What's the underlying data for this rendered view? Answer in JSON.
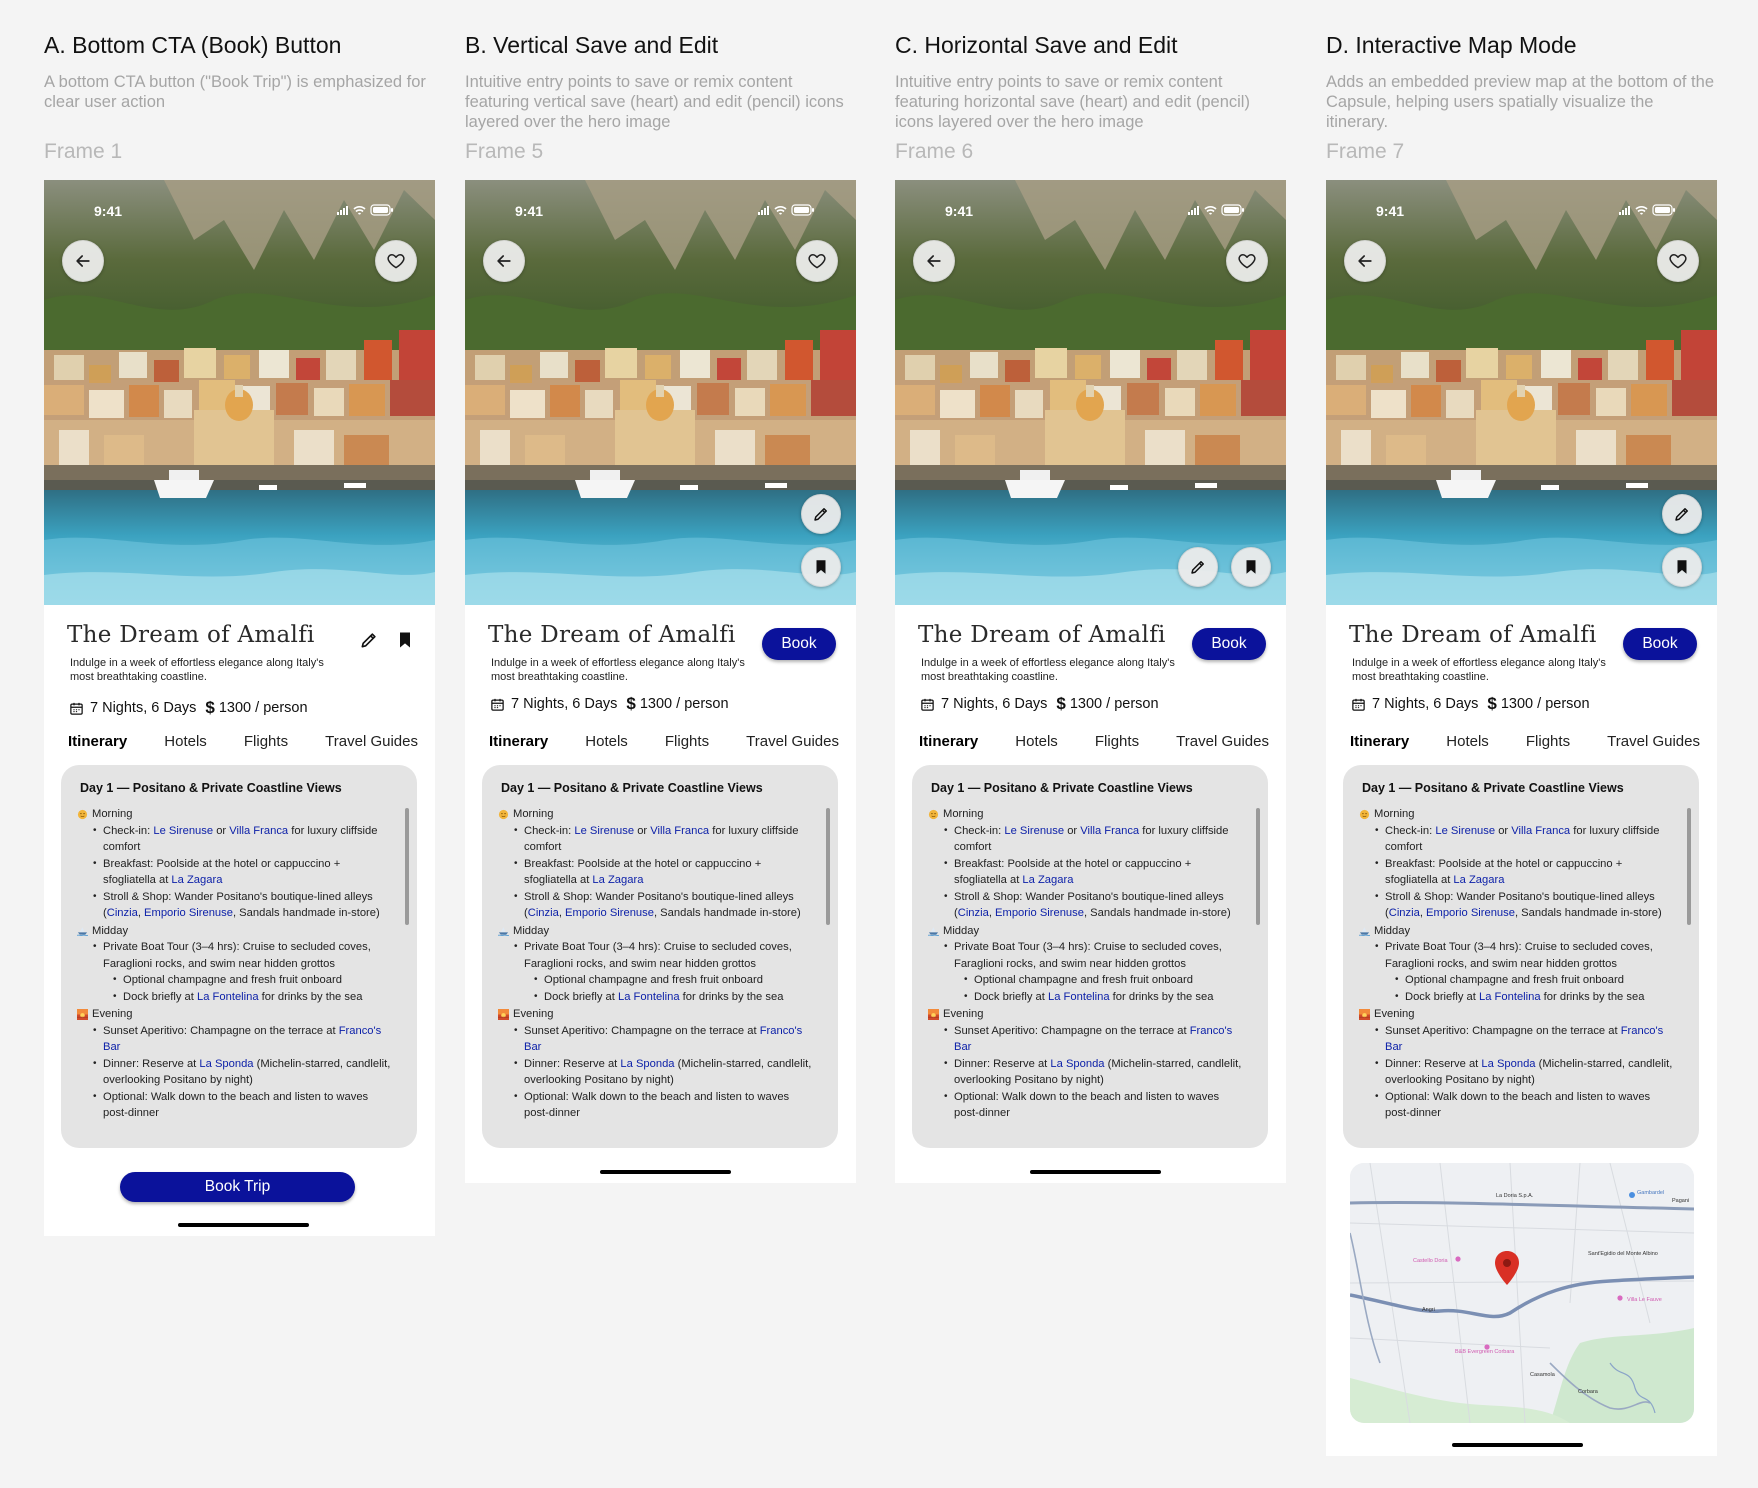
{
  "columns": [
    {
      "title": "A. Bottom CTA (Book) Button",
      "description": "A bottom CTA button (\"Book Trip\") is emphasized for clear user action",
      "frame": "Frame 1"
    },
    {
      "title": "B. Vertical Save and Edit",
      "description": "Intuitive entry points to save or remix content featuring vertical save (heart) and edit (pencil) icons layered over the hero image",
      "frame": "Frame 5"
    },
    {
      "title": "C. Horizontal Save and Edit",
      "description": "Intuitive entry points to save or remix content featuring horizontal save (heart) and edit (pencil) icons layered over the hero image",
      "frame": "Frame 6"
    },
    {
      "title": "D. Interactive Map Mode",
      "description": "Adds an embedded preview map at the bottom of the Capsule, helping users spatially visualize the itinerary.",
      "frame": "Frame 7"
    }
  ],
  "status": {
    "time": "9:41"
  },
  "trip": {
    "title": "The Dream of Amalfi",
    "description": "Indulge in a week of effortless elegance along Italy's most breathtaking coastline.",
    "duration": "7 Nights, 6 Days",
    "currency": "$",
    "price": "1300 / person",
    "book_label": "Book",
    "cta_label": "Book Trip"
  },
  "tabs": [
    "Itinerary",
    "Hotels",
    "Flights",
    "Travel Guides"
  ],
  "itinerary": {
    "day_title": "Day 1 — Positano & Private Coastline Views",
    "morning": {
      "label": "Morning",
      "checkin_pre": "Check-in: ",
      "checkin_link1": "Le Sirenuse",
      "checkin_mid": " or ",
      "checkin_link2": "Villa Franca",
      "checkin_post": " for luxury cliffside comfort",
      "breakfast_pre": "Breakfast: Poolside at the hotel or cappuccino + sfogliatella at ",
      "breakfast_link": "La Zagara",
      "stroll_pre": "Stroll & Shop: Wander Positano's boutique-lined alleys (",
      "stroll_link1": "Cinzia",
      "stroll_mid": ", ",
      "stroll_link2": "Emporio Sirenuse",
      "stroll_post": ", Sandals handmade in-store)"
    },
    "midday": {
      "label": "Midday",
      "boat": "Private Boat Tour (3–4 hrs): Cruise to secluded coves, Faraglioni rocks, and swim near hidden grottos",
      "champagne": "Optional champagne and fresh fruit onboard",
      "dock_pre": "Dock briefly at ",
      "dock_link": "La Fontelina",
      "dock_post": " for drinks by the sea"
    },
    "evening": {
      "label": "Evening",
      "sunset_pre": "Sunset Aperitivo: Champagne on the terrace at ",
      "sunset_link": "Franco's Bar",
      "dinner_pre": "Dinner: Reserve at ",
      "dinner_link": "La Sponda",
      "dinner_post": " (Michelin-starred, candlelit, overlooking Positano by night)",
      "optional": "Optional: Walk down to the beach and listen to waves post-dinner"
    }
  },
  "map": {
    "labels": [
      "La Doria S.p.A.",
      "Gambardel",
      "Pagani",
      "Sant'Egidio del Monte Albino",
      "Castello Doria",
      "Angri",
      "Villa Le Fauve",
      "B&B Evergreen Corbara",
      "Casamola",
      "Corbara"
    ]
  },
  "colors": {
    "accent": "#0b129b",
    "link": "#0b1fa8",
    "card": "#e4e4e4",
    "pin": "#d93025"
  }
}
